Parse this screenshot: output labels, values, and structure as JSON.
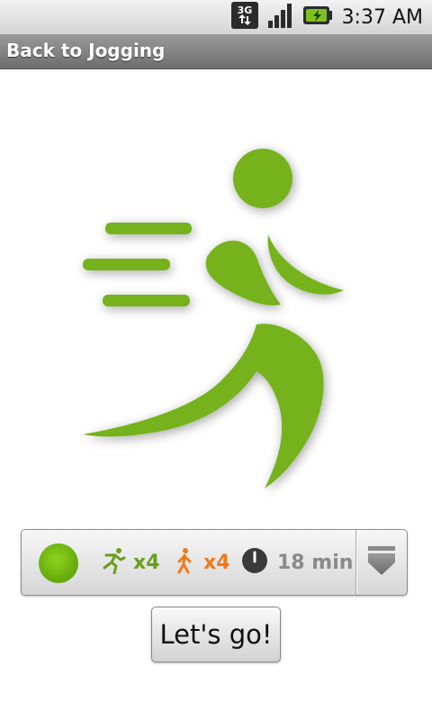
{
  "status_bar": {
    "network_label": "3G",
    "time": "3:37 AM"
  },
  "title_bar": {
    "title": "Back to Jogging"
  },
  "logo": {
    "icon": "running-man-icon",
    "color": "#74b21c"
  },
  "plan": {
    "status_color": "#6bb312",
    "run_icon": "running-icon",
    "run_count": "x4",
    "run_color": "#6a9e1f",
    "walk_icon": "walking-icon",
    "walk_count": "x4",
    "walk_color": "#f07a1a",
    "time_icon": "timer-icon",
    "duration": "18 min",
    "duration_color": "#8a8a8a"
  },
  "actions": {
    "go_label": "Let's go!"
  }
}
